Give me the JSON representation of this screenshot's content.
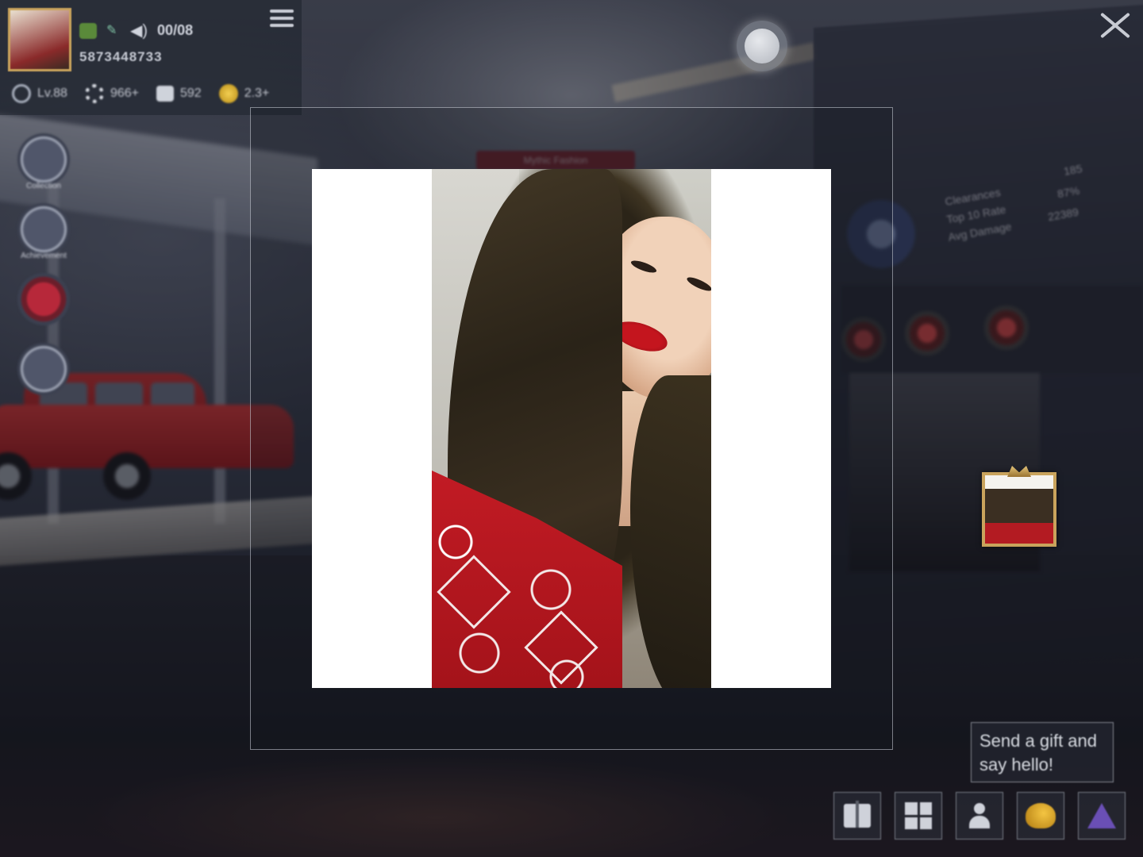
{
  "hud": {
    "player_count": "00/08",
    "player_id": "5873448733",
    "stats": [
      {
        "icon": "rank-icon",
        "value": "Lv.88"
      },
      {
        "icon": "gear-icon",
        "value": "966+"
      },
      {
        "icon": "like-icon",
        "value": "592"
      },
      {
        "icon": "coin-icon",
        "value": "2.3+"
      }
    ]
  },
  "side_icons": [
    {
      "icon": "wardrobe-icon",
      "label": "Collection"
    },
    {
      "icon": "achievement-icon",
      "label": "Achievement"
    },
    {
      "icon": "emblem-icon",
      "label": ""
    },
    {
      "icon": "mission-icon",
      "label": ""
    }
  ],
  "backdrop": {
    "banner_text": "Mythic Fashion",
    "stat_labels": [
      "Clearances",
      "Top 10 Rate",
      "Avg Damage"
    ],
    "stat_values": [
      "185",
      "87%",
      "22389"
    ]
  },
  "tooltip": {
    "text": "Send a gift and say hello!"
  },
  "actions": [
    {
      "name": "gift-button",
      "icon": "gift-icon"
    },
    {
      "name": "grid-button",
      "icon": "grid-icon"
    },
    {
      "name": "add-friend-button",
      "icon": "add-user-icon"
    },
    {
      "name": "duck-button",
      "icon": "duck-icon"
    },
    {
      "name": "triangle-button",
      "icon": "triangle-icon"
    }
  ],
  "colors": {
    "frame_gold": "#c9a35c",
    "accent_red": "#c21b24",
    "coin": "#f3cf52"
  }
}
